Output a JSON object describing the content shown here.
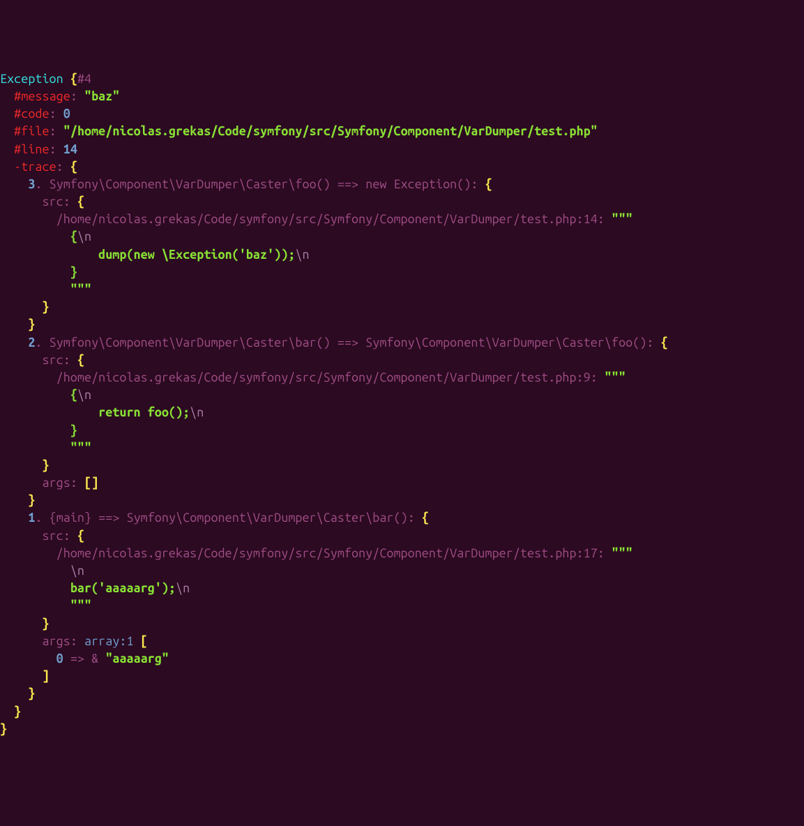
{
  "exception": {
    "class": "Exception",
    "ref": "#4",
    "message_key": "#message",
    "message_val": "baz",
    "code_key": "#code",
    "code_val": "0",
    "file_key": "#file",
    "file_val": "/home/nicolas.grekas/Code/symfony/src/Symfony/Component/VarDumper/test.php",
    "line_key": "#line",
    "line_val": "14",
    "trace_key": "-trace",
    "traces": [
      {
        "num": "3",
        "call": "Symfony\\Component\\VarDumper\\Caster\\foo() ==> new Exception()",
        "src_file": "/home/nicolas.grekas/Code/symfony/src/Symfony/Component/VarDumper/test.php:14",
        "code_open": "{",
        "nl": "\\n",
        "line_indent": "        ",
        "code_kw": "dump",
        "code_paren_open": "(",
        "code_new": "new",
        "code_rest": " \\Exception('baz'));",
        "code_close": "}"
      },
      {
        "num": "2",
        "call": "Symfony\\Component\\VarDumper\\Caster\\bar() ==> Symfony\\Component\\VarDumper\\Caster\\foo()",
        "src_file": "/home/nicolas.grekas/Code/symfony/src/Symfony/Component/VarDumper/test.php:9",
        "code_open": "{",
        "nl": "\\n",
        "line_indent": "        ",
        "code_kw": "return",
        "code_rest": " foo();",
        "code_close": "}",
        "args": "[]"
      },
      {
        "num": "1",
        "call": "{main} ==> Symfony\\Component\\VarDumper\\Caster\\bar()",
        "src_file": "/home/nicolas.grekas/Code/symfony/src/Symfony/Component/VarDumper/test.php:17",
        "nl": "\\n",
        "code_kw": "bar",
        "code_rest": "('aaaaarg');",
        "args_key": "args",
        "args_type": "array:1",
        "arg_idx": "0",
        "arg_arrow": "=>",
        "arg_amp": "&",
        "arg_val": "aaaaarg"
      }
    ]
  },
  "tokens": {
    "brace_open": "{",
    "brace_close": "}",
    "bracket_open": "[",
    "bracket_close": "]",
    "colon": ":",
    "quote": "\"",
    "triple_quote": "\"\"\"",
    "src": "src",
    "args": "args",
    "dot": "."
  }
}
